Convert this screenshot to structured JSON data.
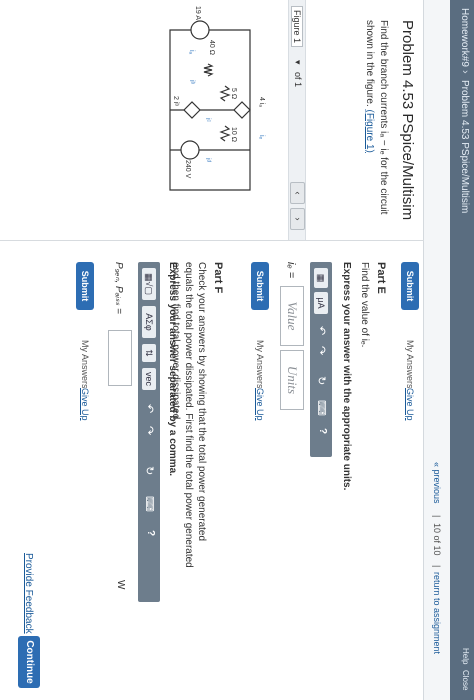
{
  "breadcrumb": [
    "Homework#9",
    "Problem 4.53 PSpice/Multisim"
  ],
  "topbar_right": [
    "Help",
    "Close"
  ],
  "nav": {
    "previous": "« previous",
    "position": "10 of 10",
    "return": "return to assignment"
  },
  "problem": {
    "title": "Problem 4.53 PSpice/Multisim",
    "text": "Find the branch currents iₐ − iₑ for the circuit shown in the figure. ",
    "figure_link": "(Figure 1)"
  },
  "figure_nav": {
    "label": "Figure 1",
    "dropdown": "▾",
    "of": "of 1",
    "prev": "‹",
    "next": "›"
  },
  "circuit": {
    "dep_source_top": "4 iₐ",
    "arrow_top": "iₑ",
    "r1": "5 Ω",
    "r2": "10 Ω",
    "r3": "40 Ω",
    "current_source": "19 A",
    "dep_source_mid": "2 iᵇ",
    "voltage_source": "240 V",
    "cur_a": "iₐ",
    "cur_b": "iᵇ",
    "cur_c": "iᶜ",
    "cur_d": "iᵈ"
  },
  "prev_part": {
    "submit": "Submit",
    "my_answers": "My Answers",
    "give_up": "Give Up"
  },
  "part_e": {
    "heading": "Part E",
    "prompt": "Find the value of iₑ.",
    "instruction": "Express your answer with the appropriate units.",
    "var_label": "iₑ =",
    "value_placeholder": "Value",
    "units_placeholder": "Units",
    "unit_btn": "μA",
    "help": "?",
    "submit": "Submit",
    "my_answers": "My Answers",
    "give_up": "Give Up"
  },
  "part_f": {
    "heading": "Part F",
    "prompt": "Check your answers by showing that the total power generated equals the total power dissipated. First find the total power generated and then find total power dissipated.",
    "instruction": "Express your answer separated by a comma.",
    "greek_btn": "AΣφ",
    "swap_btn": "⇅",
    "vec_btn": "vec",
    "help": "?",
    "var_label": "P₉ₑₙ, Pₔᵢₛₛ =",
    "unit_suffix": "W",
    "submit": "Submit",
    "my_answers": "My Answers",
    "give_up": "Give Up"
  },
  "footer": {
    "feedback": "Provide Feedback",
    "continue": "Continue"
  }
}
